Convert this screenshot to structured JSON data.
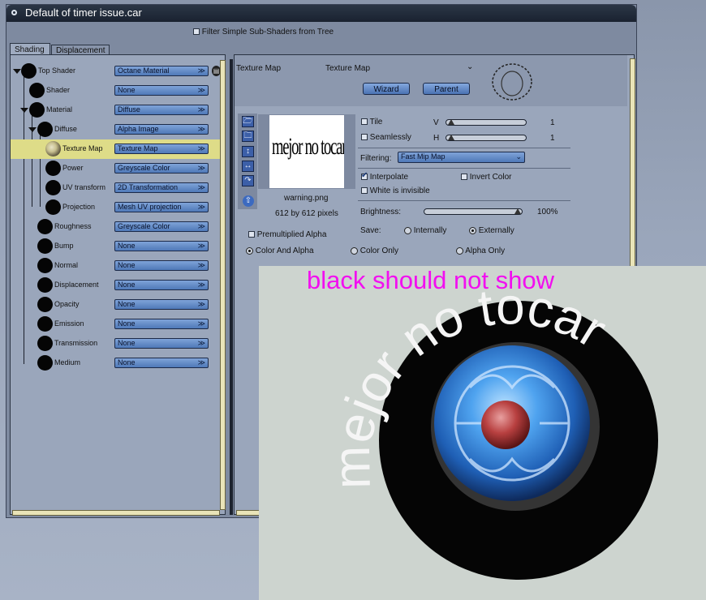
{
  "window": {
    "title": "Default of timer issue.car"
  },
  "filter": {
    "label": "Filter Simple Sub-Shaders from Tree",
    "checked": false
  },
  "tabs": [
    {
      "label": "Shading",
      "active": true
    },
    {
      "label": "Displacement",
      "active": false
    }
  ],
  "tree": [
    {
      "label": "Top Shader",
      "value": "Octane Material"
    },
    {
      "label": "Shader",
      "value": "None"
    },
    {
      "label": "Material",
      "value": "Diffuse"
    },
    {
      "label": "Diffuse",
      "value": "Alpha Image"
    },
    {
      "label": "Texture Map",
      "value": "Texture Map",
      "selected": true
    },
    {
      "label": "Power",
      "value": "Greyscale Color"
    },
    {
      "label": "UV transform",
      "value": "2D Transformation"
    },
    {
      "label": "Projection",
      "value": "Mesh UV projection"
    },
    {
      "label": "Roughness",
      "value": "Greyscale Color"
    },
    {
      "label": "Bump",
      "value": "None"
    },
    {
      "label": "Normal",
      "value": "None"
    },
    {
      "label": "Displacement",
      "value": "None"
    },
    {
      "label": "Opacity",
      "value": "None"
    },
    {
      "label": "Emission",
      "value": "None"
    },
    {
      "label": "Transmission",
      "value": "None"
    },
    {
      "label": "Medium",
      "value": "None"
    }
  ],
  "node": {
    "title": "Texture Map",
    "type": "Texture Map",
    "wizard": "Wizard",
    "parent": "Parent",
    "thumb_text": "mejor no tocar",
    "file_name": "warning.png",
    "file_size": "612 by 612 pixels"
  },
  "texture": {
    "tile": {
      "label": "Tile",
      "checked": false
    },
    "seamlessly": {
      "label": "Seamlessly",
      "checked": false
    },
    "v_label": "V",
    "v_value": "1",
    "h_label": "H",
    "h_value": "1",
    "filtering_label": "Filtering:",
    "filtering_value": "Fast Mip Map",
    "interpolate": {
      "label": "Interpolate",
      "checked": true
    },
    "invert": {
      "label": "Invert Color",
      "checked": false
    },
    "white_invisible": {
      "label": "White is invisible",
      "checked": false
    },
    "brightness_label": "Brightness:",
    "brightness_value": "100%",
    "brightness_level": 1.0,
    "save_label": "Save:",
    "save_internally": "Internally",
    "save_externally": "Externally",
    "premultiplied": {
      "label": "Premultiplied Alpha",
      "checked": false
    },
    "channels": [
      {
        "label": "Color And Alpha",
        "selected": true
      },
      {
        "label": "Color Only",
        "selected": false
      },
      {
        "label": "Alpha Only",
        "selected": false
      }
    ]
  },
  "render": {
    "note": "black should not show",
    "ring_text": "mejor no tocar",
    "colors": {
      "note": "#f20ef0",
      "ring": "#050505",
      "hub": "#2f7fd8",
      "cap": "#b84040"
    }
  }
}
